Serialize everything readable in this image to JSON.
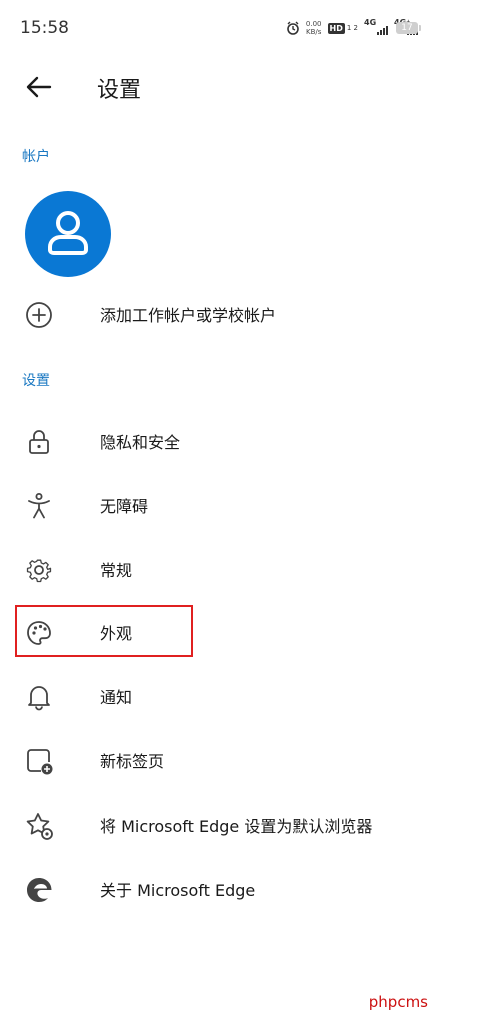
{
  "status_bar": {
    "time": "15:58",
    "speed_value": "0.00",
    "speed_unit": "KB/s",
    "hd_label": "HD",
    "hd_sub": "1 2",
    "sim1": "4G",
    "sim2": "4G⁺",
    "battery": "17"
  },
  "header": {
    "title": "设置",
    "back_icon": "arrow-left-icon"
  },
  "account_section": {
    "heading": "帐户",
    "add_account_label": "添加工作帐户或学校帐户"
  },
  "settings_section": {
    "heading": "设置",
    "items": [
      {
        "label": "隐私和安全",
        "icon": "lock-icon"
      },
      {
        "label": "无障碍",
        "icon": "accessibility-icon"
      },
      {
        "label": "常规",
        "icon": "gear-icon"
      },
      {
        "label": "外观",
        "icon": "palette-icon"
      },
      {
        "label": "通知",
        "icon": "bell-icon"
      },
      {
        "label": "新标签页",
        "icon": "new-tab-icon"
      },
      {
        "label": "将 Microsoft Edge 设置为默认浏览器",
        "icon": "star-gear-icon"
      },
      {
        "label": "关于 Microsoft Edge",
        "icon": "edge-logo-icon"
      }
    ]
  },
  "watermark": "phpcms",
  "colors": {
    "accent": "#1a78c2",
    "avatar": "#0a78d4",
    "highlight": "#e02020"
  }
}
